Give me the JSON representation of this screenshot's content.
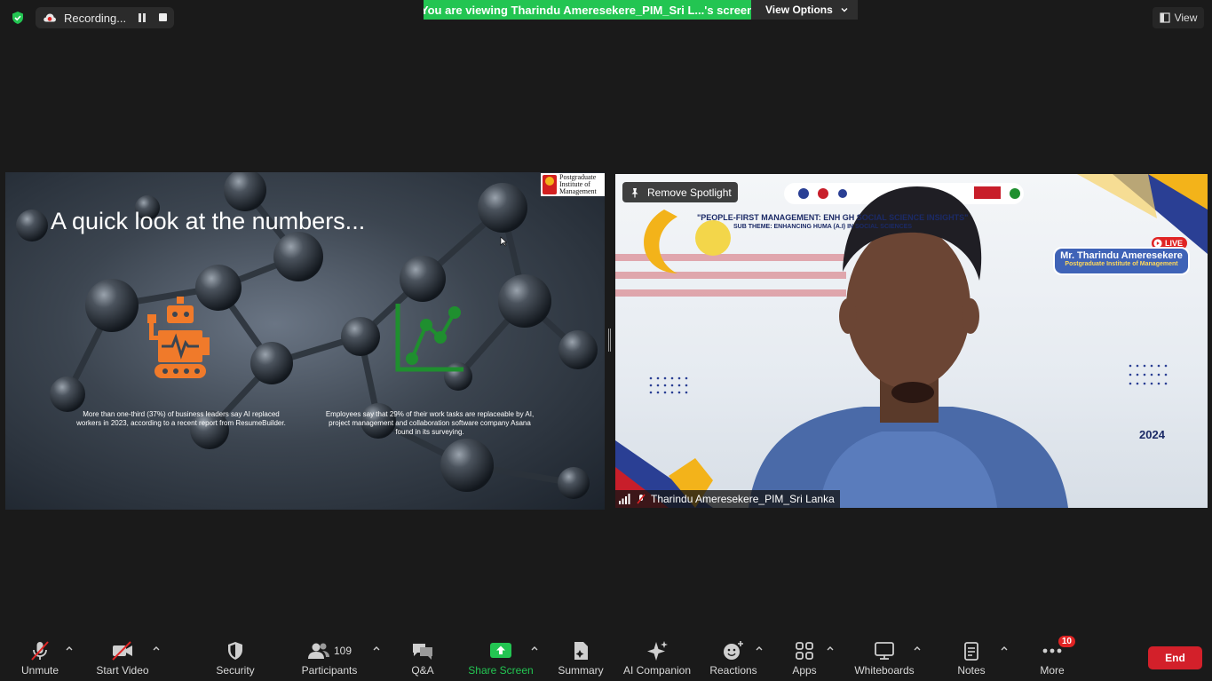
{
  "recording": {
    "label": "Recording..."
  },
  "banner": {
    "text": "You are viewing Tharindu Ameresekere_PIM_Sri L...'s screen"
  },
  "view_options": {
    "label": "View Options"
  },
  "view": {
    "label": "View"
  },
  "slide": {
    "title": "A quick look at the numbers...",
    "logo_lines": [
      "Postgraduate",
      "Institute of",
      "Management"
    ],
    "logo_mark": "PIM",
    "stat1": "More than one-third (37%) of business leaders say AI replaced workers in 2023, according to a recent report from ResumeBuilder.",
    "stat2": "Employees say that 29% of their work tasks are replaceable by AI, project management and collaboration software company Asana found in its surveying."
  },
  "video": {
    "spotlight_label": "Remove Spotlight",
    "theme_line": "\"PEOPLE-FIRST MANAGEMENT: ENH                                              GH SOCIAL SCIENCE INSIGHTS\"",
    "sub_theme": "SUB THEME:  ENHANCING HUMA                                              (A.I) IN SOCIAL SCIENCES",
    "live": "LIVE",
    "speaker_name": "Mr. Tharindu Ameresekere",
    "speaker_org": "Postgraduate Institute of Management",
    "date_fragment": "2024",
    "participant_name": "Tharindu Ameresekere_PIM_Sri Lanka"
  },
  "toolbar": {
    "unmute": "Unmute",
    "start_video": "Start Video",
    "security": "Security",
    "participants": "Participants",
    "participants_count": "109",
    "qa": "Q&A",
    "share_screen": "Share Screen",
    "summary": "Summary",
    "ai_companion": "AI Companion",
    "reactions": "Reactions",
    "apps": "Apps",
    "whiteboards": "Whiteboards",
    "notes": "Notes",
    "more": "More",
    "more_badge": "10",
    "end": "End"
  },
  "colors": {
    "banner": "#23c552",
    "end": "#d3202a",
    "robot": "#f07a2a",
    "chart_icon": "#1f8f2f"
  }
}
